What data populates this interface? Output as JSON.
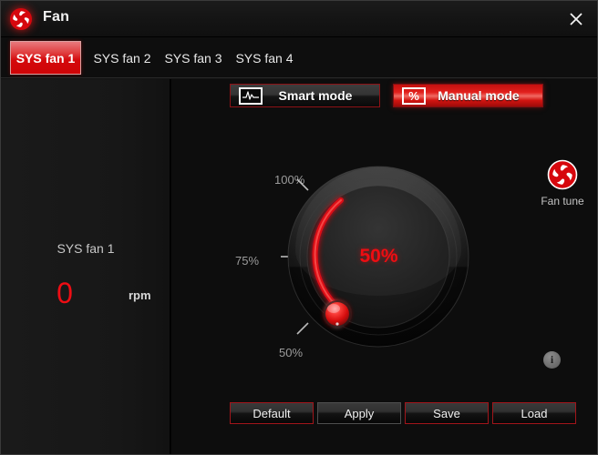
{
  "window": {
    "title": "Fan",
    "logo_icon": "msi-shutter-logo-icon",
    "close_icon": "close-icon"
  },
  "tabs": [
    {
      "label": "SYS fan 1",
      "active": true
    },
    {
      "label": "SYS fan 2",
      "active": false
    },
    {
      "label": "SYS fan 3",
      "active": false
    },
    {
      "label": "SYS fan 4",
      "active": false
    }
  ],
  "sidebar": {
    "fan_name": "SYS fan 1",
    "rpm_value": "0",
    "rpm_unit": "rpm"
  },
  "modes": {
    "smart": {
      "label": "Smart mode",
      "icon": "waveform-icon",
      "active": false
    },
    "manual": {
      "label": "Manual mode",
      "icon": "percent-icon",
      "icon_glyph": "%",
      "active": true
    }
  },
  "dial": {
    "value_label": "50%",
    "value_percent": 50,
    "scale_labels": [
      "100%",
      "75%",
      "50%"
    ],
    "arc_color": "#e61014",
    "handle_color": "#f01c1c"
  },
  "fan_tune": {
    "label": "Fan tune",
    "icon": "msi-shutter-logo-icon"
  },
  "info": {
    "icon": "info-icon",
    "glyph": "i"
  },
  "actions": [
    {
      "label": "Default",
      "style": "red"
    },
    {
      "label": "Apply",
      "style": "grey"
    },
    {
      "label": "Save",
      "style": "red"
    },
    {
      "label": "Load",
      "style": "red"
    }
  ],
  "colors": {
    "accent_red": "#e6101a",
    "active_tab_red": "#d4080b",
    "panel_bg": "#0d0d0d",
    "sidebar_bg": "#181818",
    "text_primary": "#f0f0f0",
    "text_muted": "#9b9b9b"
  }
}
